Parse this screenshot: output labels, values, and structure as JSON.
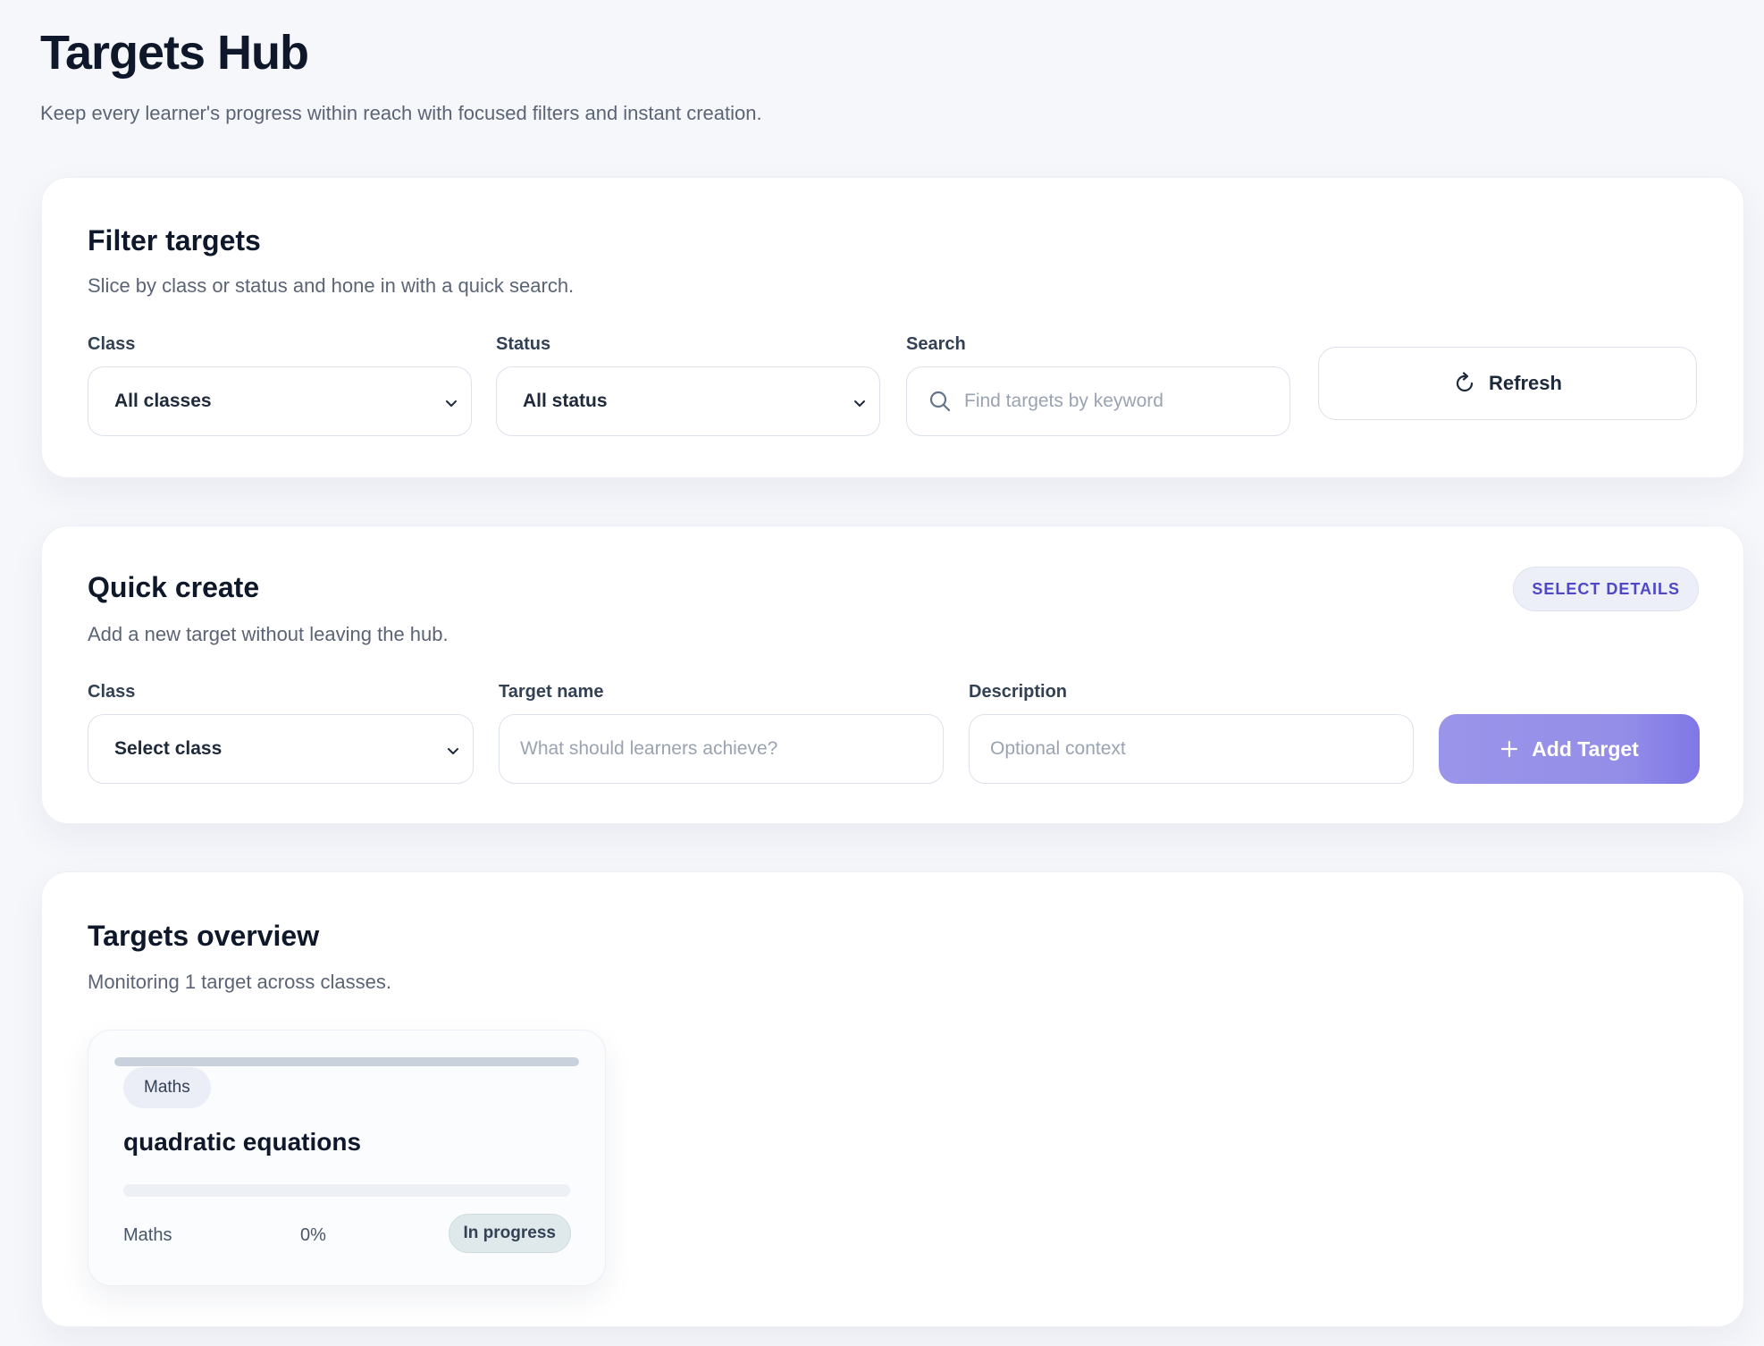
{
  "header": {
    "title": "Targets Hub",
    "subtitle": "Keep every learner's progress within reach with focused filters and instant creation."
  },
  "filter": {
    "title": "Filter targets",
    "subtitle": "Slice by class or status and hone in with a quick search.",
    "class_label": "Class",
    "class_value": "All classes",
    "status_label": "Status",
    "status_value": "All status",
    "search_label": "Search",
    "search_placeholder": "Find targets by keyword",
    "refresh_label": "Refresh"
  },
  "quick_create": {
    "title": "Quick create",
    "subtitle": "Add a new target without leaving the hub.",
    "badge": "SELECT DETAILS",
    "class_label": "Class",
    "class_value": "Select class",
    "name_label": "Target name",
    "name_placeholder": "What should learners achieve?",
    "description_label": "Description",
    "description_placeholder": "Optional context",
    "add_label": "Add Target"
  },
  "overview": {
    "title": "Targets overview",
    "subtitle": "Monitoring 1 target across classes.",
    "targets": [
      {
        "class_pill": "Maths",
        "name": "quadratic equations",
        "class": "Maths",
        "progress_label": "0%",
        "progress": 0,
        "status": "In progress"
      }
    ]
  },
  "colors": {
    "accent": "#948ee8",
    "badge_text": "#4f46c8",
    "status_bg": "#dfe8ea"
  },
  "icons": {
    "refresh": "refresh-icon",
    "search": "search-icon",
    "chevron": "chevron-down-icon",
    "plus": "plus-icon"
  }
}
